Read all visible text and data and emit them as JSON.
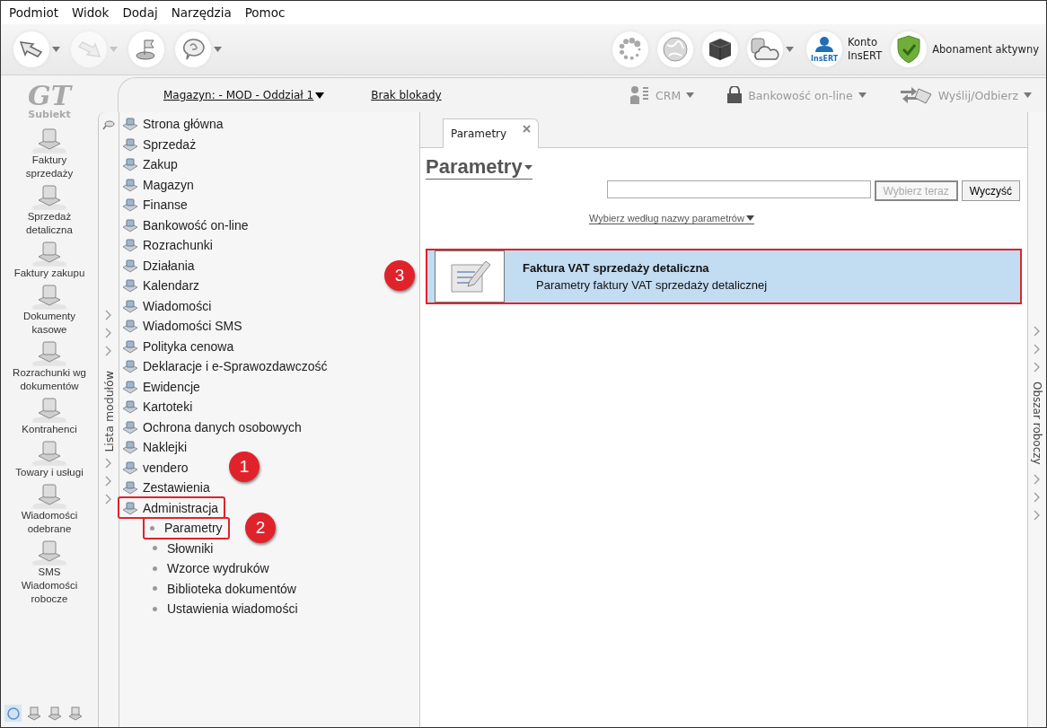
{
  "menu": [
    "Podmiot",
    "Widok",
    "Dodaj",
    "Narzędzia",
    "Pomoc"
  ],
  "toolbar": {
    "left": [
      {
        "kind": "back",
        "dropdown": true,
        "disabled": false
      },
      {
        "kind": "forward",
        "dropdown": true,
        "disabled": true
      },
      {
        "kind": "flag",
        "dropdown": false,
        "disabled": false
      },
      {
        "kind": "help",
        "dropdown": true,
        "disabled": false
      }
    ],
    "right": [
      {
        "kind": "spinner",
        "dropdown": false
      },
      {
        "kind": "globe",
        "dropdown": false
      },
      {
        "kind": "cube",
        "dropdown": false
      },
      {
        "kind": "cloud",
        "dropdown": true
      }
    ],
    "account": {
      "icon_text": "InsERT",
      "line1": "Konto",
      "line2": "InsERT"
    },
    "subscription": "Abonament aktywny"
  },
  "logo": {
    "mark": "GT",
    "name": "Subiekt"
  },
  "header": {
    "warehouse": "Magazyn: - MOD - Oddział 1",
    "lock": "Brak blokady",
    "actions": [
      {
        "kind": "crm",
        "label": "CRM",
        "disabled": true
      },
      {
        "kind": "bank",
        "label": "Bankowość on-line",
        "disabled": true
      },
      {
        "kind": "send",
        "label": "Wyślij/Odbierz",
        "disabled": true
      }
    ]
  },
  "sidebar": {
    "items": [
      {
        "label": "Faktury\nsprzedaży"
      },
      {
        "label": "Sprzedaż\ndetaliczna"
      },
      {
        "label": "Faktury zakupu"
      },
      {
        "label": "Dokumenty\nkasowe"
      },
      {
        "label": "Rozrachunki wg\ndokumentów"
      },
      {
        "label": "Kontrahenci"
      },
      {
        "label": "Towary i usługi"
      },
      {
        "label": "Wiadomości\nodebrane"
      },
      {
        "label": "SMS\nWiadomości\nrobocze"
      }
    ],
    "bottom": [
      {
        "selected": true
      },
      {
        "selected": false
      },
      {
        "selected": false
      },
      {
        "selected": false
      }
    ]
  },
  "modules": {
    "title": "Lista modułów",
    "items": [
      {
        "label": "Strona główna",
        "highlighted": false
      },
      {
        "label": "Sprzedaż",
        "highlighted": false
      },
      {
        "label": "Zakup",
        "highlighted": false
      },
      {
        "label": "Magazyn",
        "highlighted": false
      },
      {
        "label": "Finanse",
        "highlighted": false
      },
      {
        "label": "Bankowość on-line",
        "highlighted": false
      },
      {
        "label": "Rozrachunki",
        "highlighted": false
      },
      {
        "label": "Działania",
        "highlighted": false
      },
      {
        "label": "Kalendarz",
        "highlighted": false
      },
      {
        "label": "Wiadomości",
        "highlighted": false
      },
      {
        "label": "Wiadomości SMS",
        "highlighted": false
      },
      {
        "label": "Polityka cenowa",
        "highlighted": false
      },
      {
        "label": "Deklaracje i e-Sprawozdawczość",
        "highlighted": false
      },
      {
        "label": "Ewidencje",
        "highlighted": false
      },
      {
        "label": "Kartoteki",
        "highlighted": false
      },
      {
        "label": "Ochrona danych osobowych",
        "highlighted": false
      },
      {
        "label": "Naklejki",
        "highlighted": false
      },
      {
        "label": "vendero",
        "highlighted": false
      },
      {
        "label": "Zestawienia",
        "highlighted": false
      },
      {
        "label": "Administracja",
        "highlighted": true,
        "callout": "1",
        "children": [
          {
            "label": "Parametry",
            "highlighted": true,
            "callout": "2"
          },
          {
            "label": "Słowniki",
            "highlighted": false
          },
          {
            "label": "Wzorce wydruków",
            "highlighted": false
          },
          {
            "label": "Biblioteka dokumentów",
            "highlighted": false
          },
          {
            "label": "Ustawienia wiadomości",
            "highlighted": false
          }
        ]
      }
    ]
  },
  "tabs": [
    {
      "label": "Parametry",
      "selected": true
    }
  ],
  "content": {
    "title": "Parametry",
    "buttons": [
      {
        "label": "Wybierz teraz",
        "disabled": true
      },
      {
        "label": "Wyczyść",
        "disabled": false
      }
    ],
    "filter": "Wybierz według nazwy parametrów",
    "results": [
      {
        "title": "Faktura VAT sprzedaży detaliczna",
        "description": "Parametry faktury VAT sprzedaży detalicznej",
        "selected": true,
        "highlighted": true,
        "callout": "3"
      }
    ]
  },
  "workspace": {
    "title": "Obszar roboczy"
  }
}
